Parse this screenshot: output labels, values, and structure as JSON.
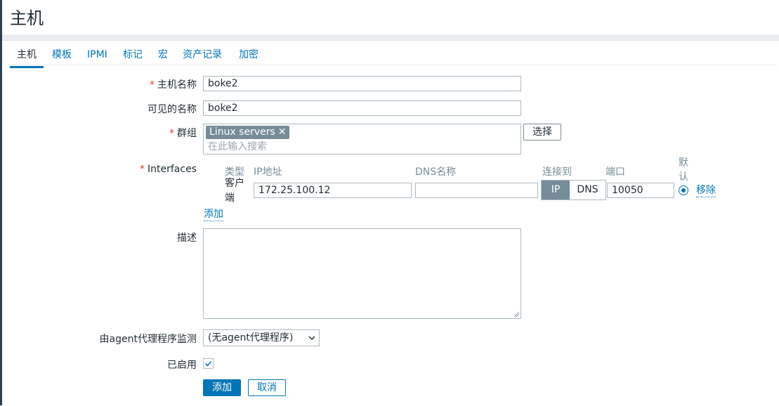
{
  "header": {
    "title": "主机"
  },
  "tabs": [
    {
      "label": "主机"
    },
    {
      "label": "模板"
    },
    {
      "label": "IPMI"
    },
    {
      "label": "标记"
    },
    {
      "label": "宏"
    },
    {
      "label": "资产记录"
    },
    {
      "label": "加密"
    }
  ],
  "form": {
    "host_name": {
      "label": "主机名称",
      "value": "boke2"
    },
    "visible_name": {
      "label": "可见的名称",
      "value": "boke2"
    },
    "groups": {
      "label": "群组",
      "chip": "Linux servers",
      "chip_remove": "✕",
      "placeholder": "在此输入搜索",
      "select_button": "选择"
    },
    "interfaces": {
      "label": "Interfaces",
      "headers": {
        "type": "类型",
        "ip": "IP地址",
        "dns": "DNS名称",
        "connect": "连接到",
        "port": "端口",
        "default": "默认"
      },
      "row": {
        "type": "客户端",
        "ip": "172.25.100.12",
        "dns": "",
        "connect_ip": "IP",
        "connect_dns": "DNS",
        "port": "10050",
        "remove": "移除"
      },
      "add_link": "添加"
    },
    "description": {
      "label": "描述"
    },
    "proxy": {
      "label": "由agent代理程序监测",
      "value": "(无agent代理程序)"
    },
    "enabled": {
      "label": "已启用",
      "checked": true
    }
  },
  "buttons": {
    "add": "添加",
    "cancel": "取消"
  },
  "required_marker": "*",
  "colors": {
    "accent": "#0275b8",
    "required": "#e33734",
    "chip": "#768d99"
  }
}
